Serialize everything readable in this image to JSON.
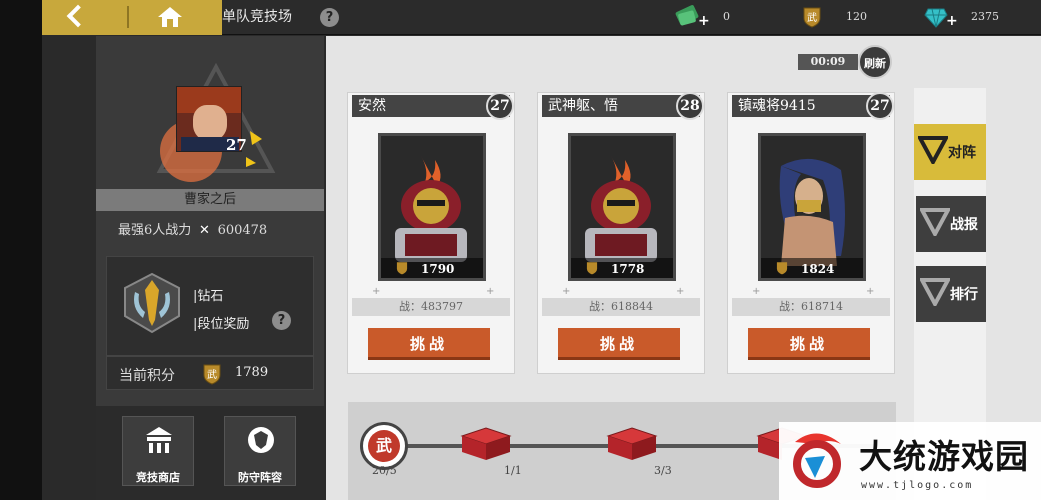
{
  "header": {
    "title": "单队竞技场",
    "resources": [
      {
        "name": "cash",
        "value": "0"
      },
      {
        "name": "wu-coin",
        "value": "120"
      },
      {
        "name": "diamond",
        "value": "2375"
      }
    ]
  },
  "player": {
    "level": "27",
    "name": "曹家之后",
    "power_label": "最强6人战力",
    "power_value": "600478",
    "rank_tier": "|钻石",
    "rank_reward": "|段位奖励",
    "score_label": "当前积分",
    "score_value": "1789",
    "buttons": [
      {
        "label": "竞技商店"
      },
      {
        "label": "防守阵容"
      }
    ]
  },
  "timer": "00:09",
  "refresh_label": "刷新",
  "opponents": [
    {
      "name": "安然",
      "level": "27",
      "score": "1790",
      "power": "战：483797",
      "challenge": "挑战"
    },
    {
      "name": "武神躯、悟",
      "level": "28",
      "score": "1778",
      "power": "战：618844",
      "challenge": "挑战"
    },
    {
      "name": "镇魂将9415",
      "level": "27",
      "score": "1824",
      "power": "战：618714",
      "challenge": "挑战"
    }
  ],
  "tabs": [
    {
      "label": "对阵",
      "active": true
    },
    {
      "label": "战报",
      "active": false
    },
    {
      "label": "排行",
      "active": false
    }
  ],
  "progress": {
    "badge": "武",
    "current": "20/5",
    "milestones": [
      "1/1",
      "3/3"
    ]
  },
  "watermark": {
    "text": "大统游戏园",
    "url": "www.tjlogo.com"
  },
  "colors": {
    "accent_gold": "#c8a83c",
    "challenge_orange": "#c95a2a",
    "active_tab": "#d8bb3a"
  }
}
